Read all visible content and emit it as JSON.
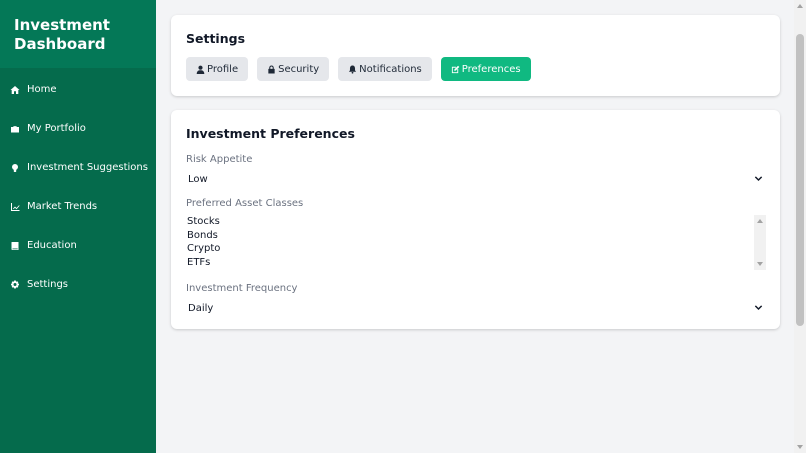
{
  "sidebar": {
    "brand_line1": "Investment",
    "brand_line2": "Dashboard",
    "items": [
      {
        "label": "Home",
        "icon": "home-icon"
      },
      {
        "label": "My Portfolio",
        "icon": "briefcase-icon"
      },
      {
        "label": "Investment Suggestions",
        "icon": "lightbulb-icon"
      },
      {
        "label": "Market Trends",
        "icon": "chart-line-icon"
      },
      {
        "label": "Education",
        "icon": "book-icon"
      },
      {
        "label": "Settings",
        "icon": "gear-icon"
      }
    ]
  },
  "settings": {
    "title": "Settings",
    "tabs": [
      {
        "label": "Profile",
        "icon": "user-icon"
      },
      {
        "label": "Security",
        "icon": "lock-icon"
      },
      {
        "label": "Notifications",
        "icon": "bell-icon"
      },
      {
        "label": "Preferences",
        "icon": "edit-icon",
        "active": true
      }
    ]
  },
  "preferences": {
    "title": "Investment Preferences",
    "risk_label": "Risk Appetite",
    "risk_value": "Low",
    "asset_label": "Preferred Asset Classes",
    "asset_options": [
      "Stocks",
      "Bonds",
      "Crypto",
      "ETFs"
    ],
    "frequency_label": "Investment Frequency",
    "frequency_value": "Daily"
  },
  "colors": {
    "sidebar_bg": "#056b4c",
    "brand_bg": "#047857",
    "accent": "#10b981",
    "tab_bg": "#e5e7eb",
    "page_bg": "#f3f4f6"
  }
}
